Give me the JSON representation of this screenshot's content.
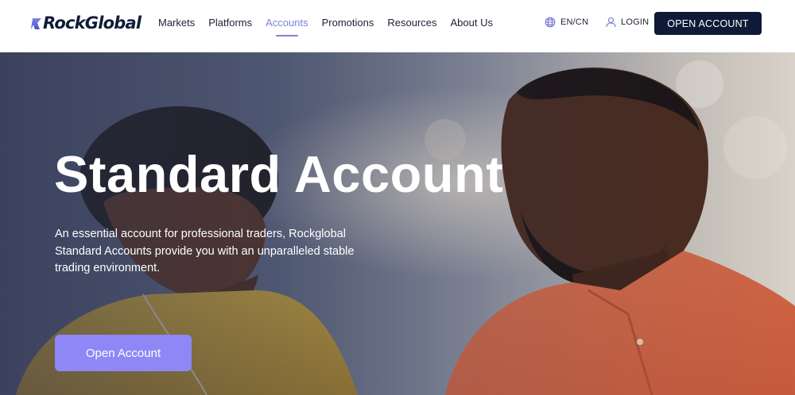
{
  "brand": {
    "name": "RockGlobal",
    "accent": "#7b80dc",
    "navy": "#0e1a36",
    "cta_color": "#8d88f5"
  },
  "nav": {
    "items": [
      {
        "label": "Markets"
      },
      {
        "label": "Platforms"
      },
      {
        "label": "Accounts",
        "active": true
      },
      {
        "label": "Promotions"
      },
      {
        "label": "Resources"
      },
      {
        "label": "About Us"
      }
    ]
  },
  "header": {
    "language_label": "EN/CN",
    "language_icon": "globe-icon",
    "login_label": "LOGIN",
    "login_icon": "user-icon",
    "open_account_label": "OPEN ACCOUNT"
  },
  "hero": {
    "title": "Standard Account",
    "description": "An essential account for professional traders, Rockglobal Standard Accounts provide you with an unparalleled stable trading environment.",
    "cta_label": "Open Account"
  }
}
